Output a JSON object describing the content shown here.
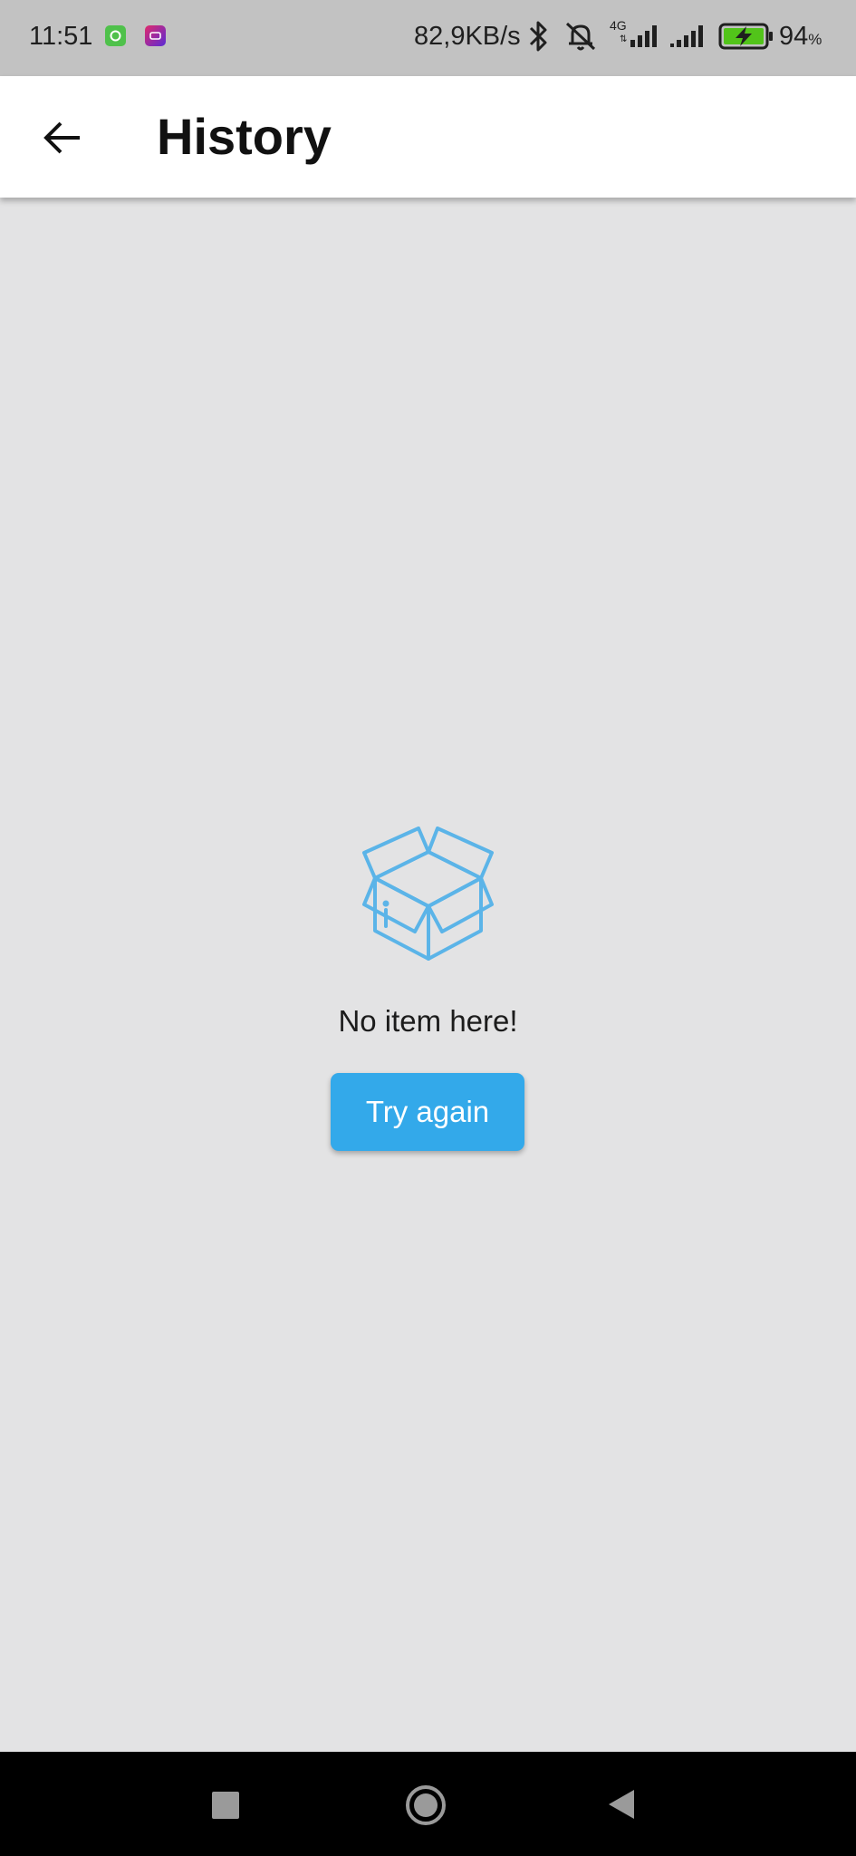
{
  "status_bar": {
    "time": "11:51",
    "network_speed": "82,9KB/s",
    "network_type": "4G",
    "battery_level": "94",
    "battery_unit": "%",
    "icons": [
      "notification-app-icon",
      "notification-app-icon",
      "bluetooth-icon",
      "silent-bell-icon",
      "signal-icon",
      "signal-icon",
      "battery-charging-icon"
    ]
  },
  "app_bar": {
    "title": "History",
    "back_icon": "arrow-left-icon"
  },
  "empty_state": {
    "icon": "open-box-icon",
    "message": "No item here!",
    "retry_label": "Try again"
  },
  "nav_bar": {
    "icons": [
      "recents-square-icon",
      "home-circle-icon",
      "back-triangle-icon"
    ]
  },
  "colors": {
    "accent": "#33a9ea",
    "icon_blue": "#5bb4e8",
    "background": "#e3e3e4",
    "status_bar": "#c2c2c2",
    "battery_green": "#52c41a"
  }
}
